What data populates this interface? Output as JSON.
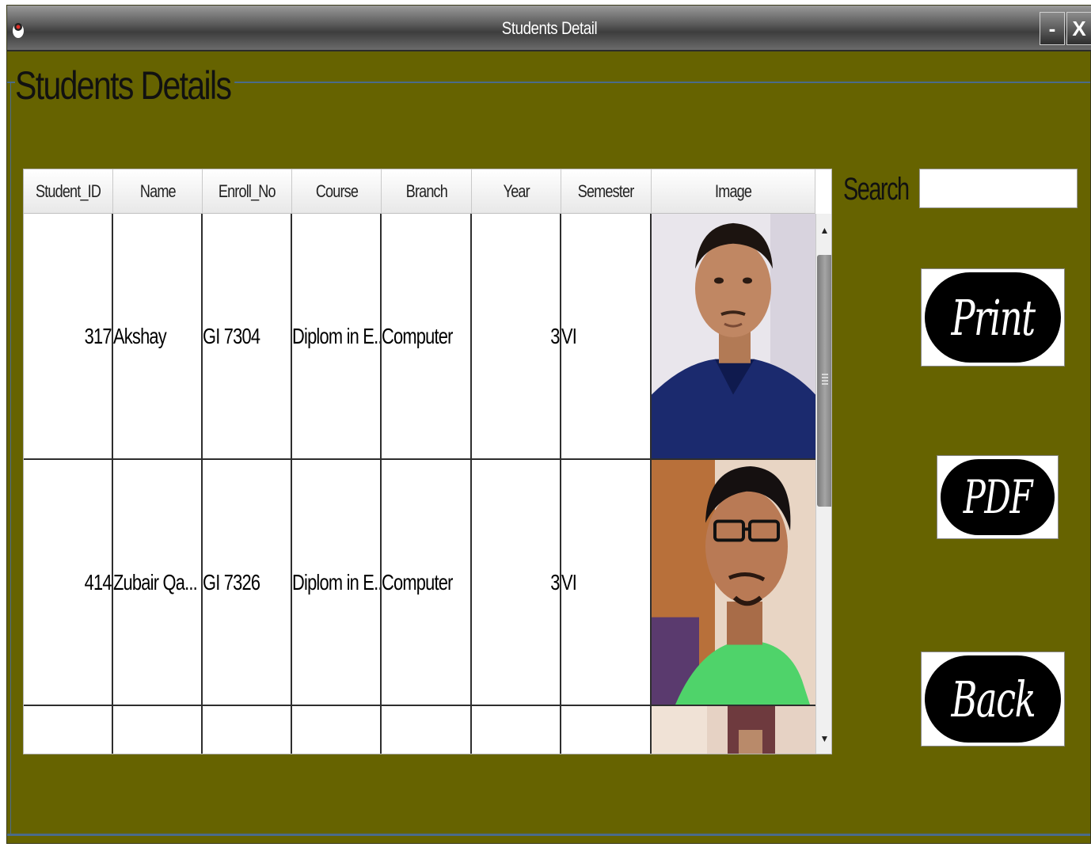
{
  "window": {
    "title": "Students Detail",
    "minimize_label": "-",
    "close_label": "X"
  },
  "group": {
    "title": "Students Details"
  },
  "table": {
    "columns": [
      "Student_ID",
      "Name",
      "Enroll_No",
      "Course",
      "Branch",
      "Year",
      "Semester",
      "Image"
    ],
    "rows": [
      {
        "student_id": "317",
        "name": "Akshay",
        "enroll_no": "GI 7304",
        "course": "Diplom in E...",
        "branch": "Computer",
        "year": "3",
        "semester": "VI",
        "image": "student-photo-1"
      },
      {
        "student_id": "414",
        "name": "Zubair Qa...",
        "enroll_no": "GI 7326",
        "course": "Diplom in E...",
        "branch": "Computer",
        "year": "3",
        "semester": "VI",
        "image": "student-photo-2"
      },
      {
        "student_id": "",
        "name": "",
        "enroll_no": "",
        "course": "",
        "branch": "",
        "year": "",
        "semester": "",
        "image": "student-photo-3"
      }
    ]
  },
  "search": {
    "label": "Search",
    "value": ""
  },
  "buttons": {
    "print": "Print",
    "pdf": "PDF",
    "back": "Back"
  },
  "colors": {
    "background": "#666300",
    "button_fill": "#000000",
    "accent_line": "#4a6b8a"
  },
  "icons": {
    "app": "duke-icon",
    "scroll_up": "scroll-up-arrow-icon",
    "scroll_down": "scroll-down-arrow-icon"
  }
}
